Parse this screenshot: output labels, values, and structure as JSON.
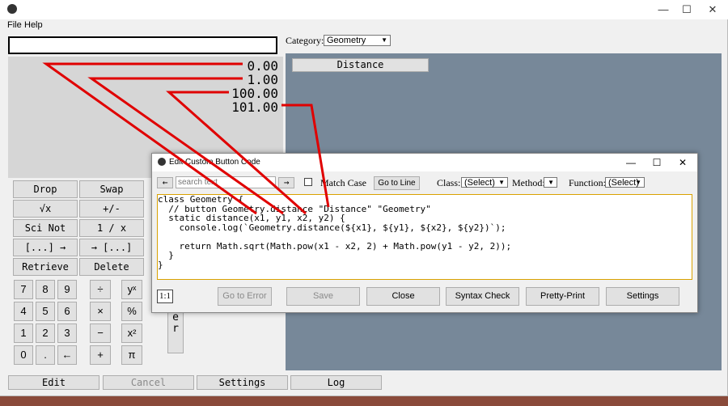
{
  "menu": {
    "file": "File",
    "help": "Help"
  },
  "window_controls": {
    "minimize": "—",
    "maximize": "☐",
    "close": "✕"
  },
  "stack": {
    "input_value": "",
    "values": [
      "0.00",
      "1.00",
      "100.00",
      "101.00"
    ]
  },
  "category": {
    "label": "Category:",
    "value": "Geometry"
  },
  "custom_buttons": {
    "distance": "Distance"
  },
  "func_buttons": {
    "drop": "Drop",
    "swap": "Swap",
    "sqrt": "√x",
    "neg": "+/-",
    "sci": "Sci Not",
    "recip": "1 / x",
    "pack": "[...] →",
    "unpack": "→ [...]",
    "retrieve": "Retrieve",
    "delete": "Delete"
  },
  "keypad": {
    "k7": "7",
    "k8": "8",
    "k9": "9",
    "k4": "4",
    "k5": "5",
    "k6": "6",
    "k1": "1",
    "k2": "2",
    "k3": "3",
    "k0": "0",
    "dot": ".",
    "back": "←",
    "div": "÷",
    "mul": "×",
    "sub": "−",
    "add": "+",
    "pow": "yˣ",
    "pct": "%",
    "sq": "x²",
    "pi": "π",
    "enter": "Enter"
  },
  "bottom": {
    "edit": "Edit",
    "cancel": "Cancel",
    "settings": "Settings",
    "log": "Log"
  },
  "dialog": {
    "title": "Edit Custom Button Code",
    "search_placeholder": "search text",
    "back": "←",
    "forward": "→",
    "match_case": "Match Case",
    "go_to_line": "Go to Line",
    "class_label": "Class:",
    "class_value": "(Select)",
    "method_label": "Method:",
    "method_value": "",
    "function_label": "Function:",
    "function_value": "(Select)",
    "code": "class Geometry {\n  // button Geometry.distance \"Distance\" \"Geometry\"\n  static distance(x1, y1, x2, y2) {\n    console.log(`Geometry.distance(${x1}, ${y1}, ${x2}, ${y2})`);\n\n    return Math.sqrt(Math.pow(x1 - x2, 2) + Math.pow(y1 - y2, 2));\n  }\n}",
    "position": "1:1",
    "go_to_error": "Go to Error",
    "save": "Save",
    "close": "Close",
    "syntax_check": "Syntax Check",
    "pretty_print": "Pretty-Print",
    "settings": "Settings"
  },
  "colors": {
    "panel": "#778899",
    "arrow": "#e00000",
    "highlight_border": "#d9a100"
  }
}
